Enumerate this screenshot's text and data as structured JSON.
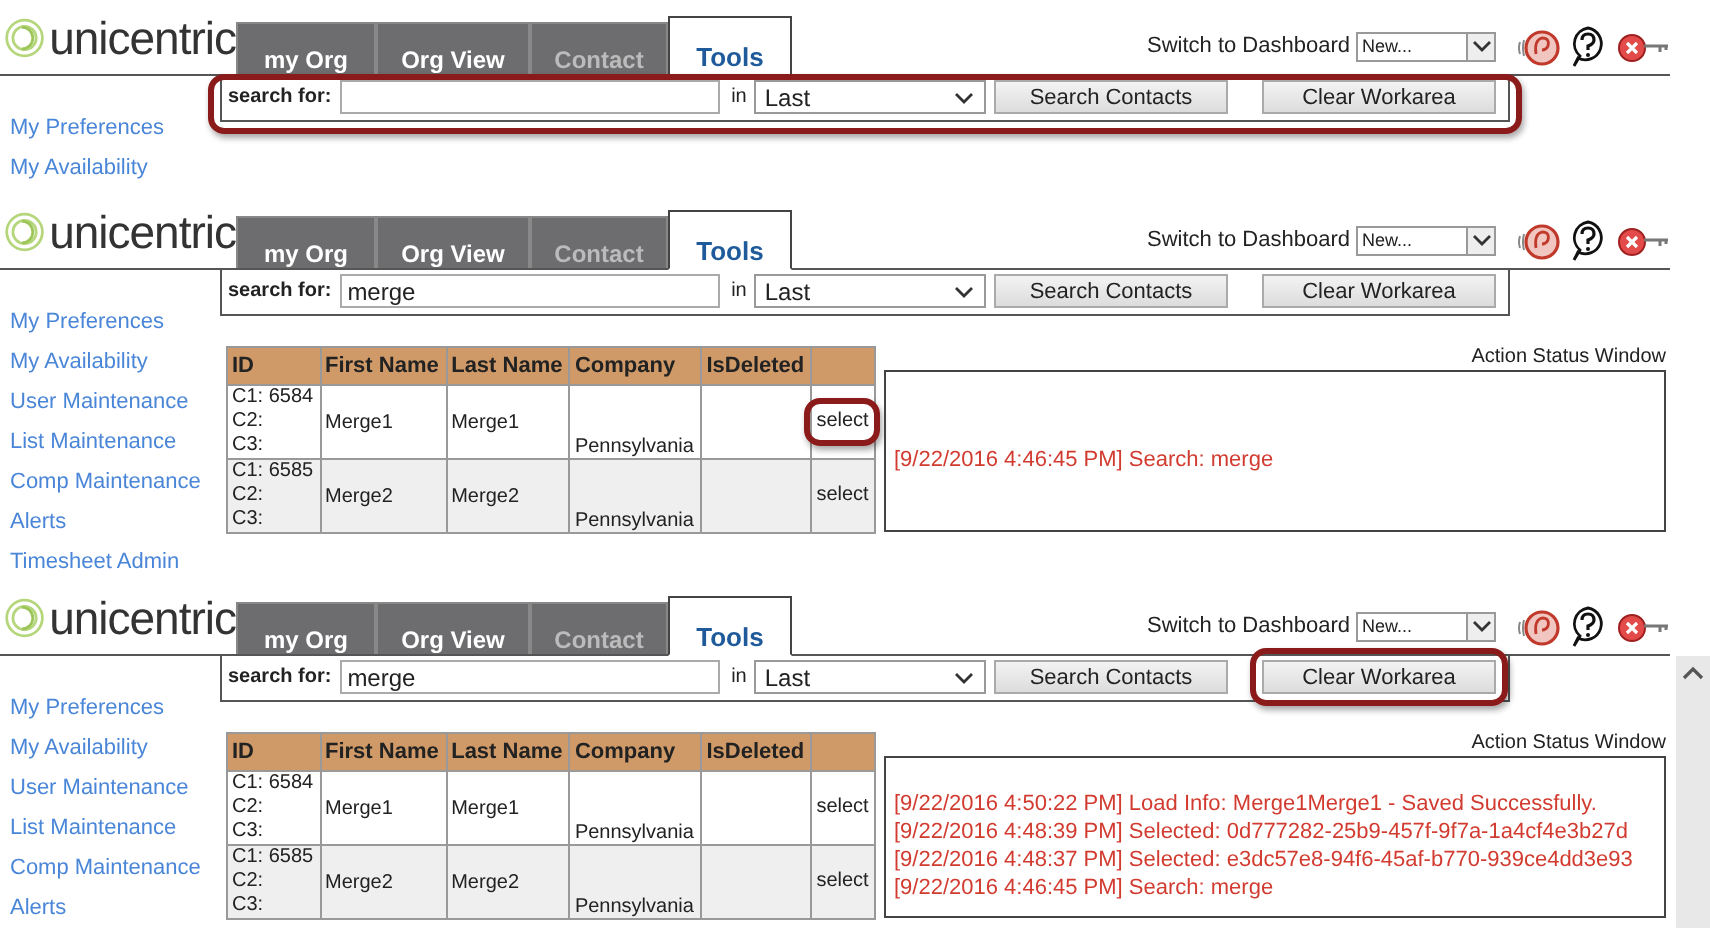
{
  "panels": [
    {
      "logo": "unicentric",
      "tabs": [
        {
          "label": "my Org",
          "selected": false,
          "disabled": false
        },
        {
          "label": "Org View",
          "selected": false,
          "disabled": false
        },
        {
          "label": "Contact",
          "selected": false,
          "disabled": true
        },
        {
          "label": "Tools",
          "selected": true,
          "disabled": false
        }
      ],
      "dashboard": {
        "label": "Switch to Dashboard",
        "value": "New..."
      },
      "search": {
        "label": "search for:",
        "in_label": "in",
        "field": "Last",
        "highlighted": true
      },
      "buttons": [
        {
          "label": "Search Contacts",
          "highlighted": false
        },
        {
          "label": "Clear Workarea",
          "highlighted": false
        }
      ],
      "sidebar": [
        "My Preferences",
        "My Availability"
      ]
    },
    {
      "logo": "unicentric",
      "tabs": [
        {
          "label": "my Org",
          "selected": false,
          "disabled": false
        },
        {
          "label": "Org View",
          "selected": false,
          "disabled": false
        },
        {
          "label": "Contact",
          "selected": false,
          "disabled": true
        },
        {
          "label": "Tools",
          "selected": true,
          "disabled": false
        }
      ],
      "dashboard": {
        "label": "Switch to Dashboard",
        "value": "New..."
      },
      "search": {
        "label": "search for:",
        "value": "merge",
        "in_label": "in",
        "field": "Last",
        "highlighted": false
      },
      "buttons": [
        {
          "label": "Search Contacts",
          "highlighted": false
        },
        {
          "label": "Clear Workarea",
          "highlighted": false
        }
      ],
      "sidebar": [
        "My Preferences",
        "My Availability",
        "User Maintenance",
        "List Maintenance",
        "Comp Maintenance",
        "Alerts",
        "Timesheet Admin"
      ],
      "table": {
        "columns": [
          "ID",
          "First Name",
          "Last Name",
          "Company",
          "IsDeleted"
        ],
        "rows": [
          {
            "id": "C1: 6584\nC2:\nC3:",
            "first": "Merge1",
            "last": "Merge1",
            "company": "Pennsylvania",
            "action": "select",
            "highlighted": true
          },
          {
            "id": "C1: 6585\nC2:\nC3:",
            "first": "Merge2",
            "last": "Merge2",
            "company": "Pennsylvania",
            "action": "select",
            "highlighted": false
          }
        ]
      },
      "status": {
        "title": "Action Status Window",
        "messages": [
          "[9/22/2016 4:46:45 PM] Search: merge"
        ]
      }
    },
    {
      "logo": "unicentric",
      "tabs": [
        {
          "label": "my Org",
          "selected": false,
          "disabled": false
        },
        {
          "label": "Org View",
          "selected": false,
          "disabled": false
        },
        {
          "label": "Contact",
          "selected": false,
          "disabled": true
        },
        {
          "label": "Tools",
          "selected": true,
          "disabled": false
        }
      ],
      "dashboard": {
        "label": "Switch to Dashboard",
        "value": "New..."
      },
      "search": {
        "label": "search for:",
        "value": "merge",
        "in_label": "in",
        "field": "Last",
        "highlighted": false
      },
      "buttons": [
        {
          "label": "Search Contacts",
          "highlighted": false
        },
        {
          "label": "Clear Workarea",
          "highlighted": true
        }
      ],
      "sidebar": [
        "My Preferences",
        "My Availability",
        "User Maintenance",
        "List Maintenance",
        "Comp Maintenance",
        "Alerts"
      ],
      "table": {
        "columns": [
          "ID",
          "First Name",
          "Last Name",
          "Company",
          "IsDeleted"
        ],
        "rows": [
          {
            "id": "C1: 6584\nC2:\nC3:",
            "first": "Merge1",
            "last": "Merge1",
            "company": "Pennsylvania",
            "action": "select",
            "highlighted": false
          },
          {
            "id": "C1: 6585\nC2:\nC3:",
            "first": "Merge2",
            "last": "Merge2",
            "company": "Pennsylvania",
            "action": "select",
            "highlighted": false
          }
        ]
      },
      "status": {
        "title": "Action Status Window",
        "messages": [
          "[9/22/2016 4:50:22 PM] Load Info: Merge1Merge1 - Saved Successfully.",
          "[9/22/2016 4:48:39 PM] Selected: 0d777282-25b9-457f-9f7a-1a4cf4e3b27d",
          "[9/22/2016 4:48:37 PM] Selected: e3dc57e8-94f6-45af-b770-939ce4dd3e93",
          "[9/22/2016 4:46:45 PM] Search: merge"
        ]
      },
      "scrollbar": true
    }
  ]
}
